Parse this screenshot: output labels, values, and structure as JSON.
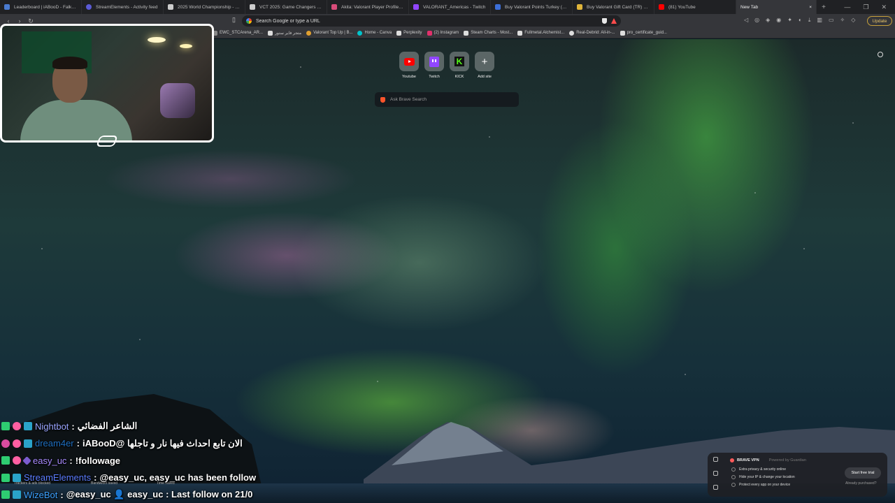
{
  "tabs": [
    {
      "label": "Leaderboard | iABooD - Falkorie",
      "color": "#4a7bd0"
    },
    {
      "label": "StreamElements - Activity feed",
      "color": "#5b5bd6"
    },
    {
      "label": "2025 World Championship - Liquip",
      "color": "#cccccc"
    },
    {
      "label": "VCT 2025: Game Changers Pacific",
      "color": "#cccccc"
    },
    {
      "label": "Akita: Valorant Player Profile | VLR",
      "color": "#d94c7a"
    },
    {
      "label": "VALORANT_Americas - Twitch",
      "color": "#9146ff"
    },
    {
      "label": "Buy Valorant Points Turkey (VP) -",
      "color": "#3c6fd8"
    },
    {
      "label": "Buy Valorant Gift Card (TR) Online",
      "color": "#e0b53a"
    },
    {
      "label": "(81) YouTube",
      "color": "#ff0000"
    }
  ],
  "active_tab": {
    "label": "New Tab",
    "close": "×"
  },
  "omnibox": {
    "placeholder": "Search Google or type a URL"
  },
  "update_label": "Update",
  "bookmarks": [
    {
      "label": "EWC_STCArena_AR...",
      "color": "#888888"
    },
    {
      "label": "متجر فاير ستور",
      "color": "#dddddd"
    },
    {
      "label": "Valorant Top Up | B...",
      "color": "#e0a030"
    },
    {
      "label": "Home - Canva",
      "color": "#00c4cc"
    },
    {
      "label": "Perplexity",
      "color": "#dddddd"
    },
    {
      "label": "(2) Instagram",
      "color": "#e1306c"
    },
    {
      "label": "Steam Charts - Most...",
      "color": "#dddddd"
    },
    {
      "label": "Fullmetal.Alchemist...",
      "color": "#dddddd"
    },
    {
      "label": "Real-Debrid: All-in-...",
      "color": "#dddddd"
    },
    {
      "label": "pro_certificate_guid...",
      "color": "#dddddd"
    }
  ],
  "top_sites": [
    {
      "label": "Youtube",
      "icon": "youtube-icon"
    },
    {
      "label": "Twitch",
      "icon": "twitch-icon"
    },
    {
      "label": "KICK",
      "icon": "kick-icon"
    },
    {
      "label": "Add site",
      "icon": "plus-icon"
    }
  ],
  "brave_search": {
    "placeholder": "Ask Brave Search"
  },
  "chat": [
    {
      "user": "Nightbot",
      "sep": ":",
      "message": "الشاعر الفضائي",
      "rtl": true
    },
    {
      "user": "dream4er",
      "sep": ":",
      "message": "الان تابع احداث فيها نار و تاجلها @iABooD",
      "rtl": true
    },
    {
      "user": "easy_uc",
      "sep": ":",
      "message": "!followage",
      "rtl": false
    },
    {
      "user": "StreamElements",
      "sep": ":",
      "message": "@easy_uc, easy_uc has been follow",
      "rtl": false
    },
    {
      "user": "WizeBot",
      "sep": ":",
      "message": "@easy_uc 👤 easy_uc : Last follow on 21/0",
      "rtl": false
    }
  ],
  "stats_faded": [
    "Trackers & ads blocked",
    "Bandwidth saved",
    "Time saved"
  ],
  "vpn": {
    "title": "BRAVE VPN",
    "powered": "Powered by Guardian",
    "features": [
      "Extra privacy & security online",
      "Hide your IP & change your location",
      "Protect every app on your device"
    ],
    "cta": "Start free trial",
    "already": "Already purchased?"
  }
}
